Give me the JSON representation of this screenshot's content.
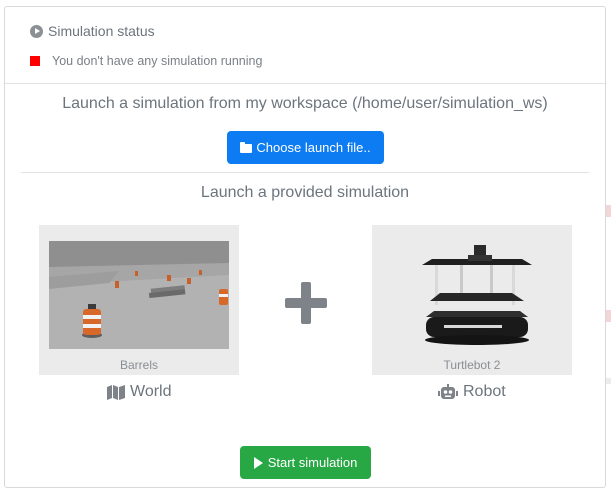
{
  "status": {
    "title": "Simulation status",
    "message": "You don't have any simulation running",
    "indicator_color": "#ff0000"
  },
  "workspace": {
    "title": "Launch a simulation from my workspace (/home/user/simulation_ws)",
    "choose_button": "Choose launch file.."
  },
  "provided": {
    "title": "Launch a provided simulation",
    "world": {
      "thumb_label": "Barrels",
      "caption": "World",
      "icon": "map-icon"
    },
    "robot": {
      "thumb_label": "Turtlebot 2",
      "caption": "Robot",
      "icon": "robot-icon"
    },
    "plus_icon": "plus-icon"
  },
  "start_button": "Start simulation",
  "colors": {
    "primary": "#0d7bf1",
    "success": "#28a745"
  }
}
